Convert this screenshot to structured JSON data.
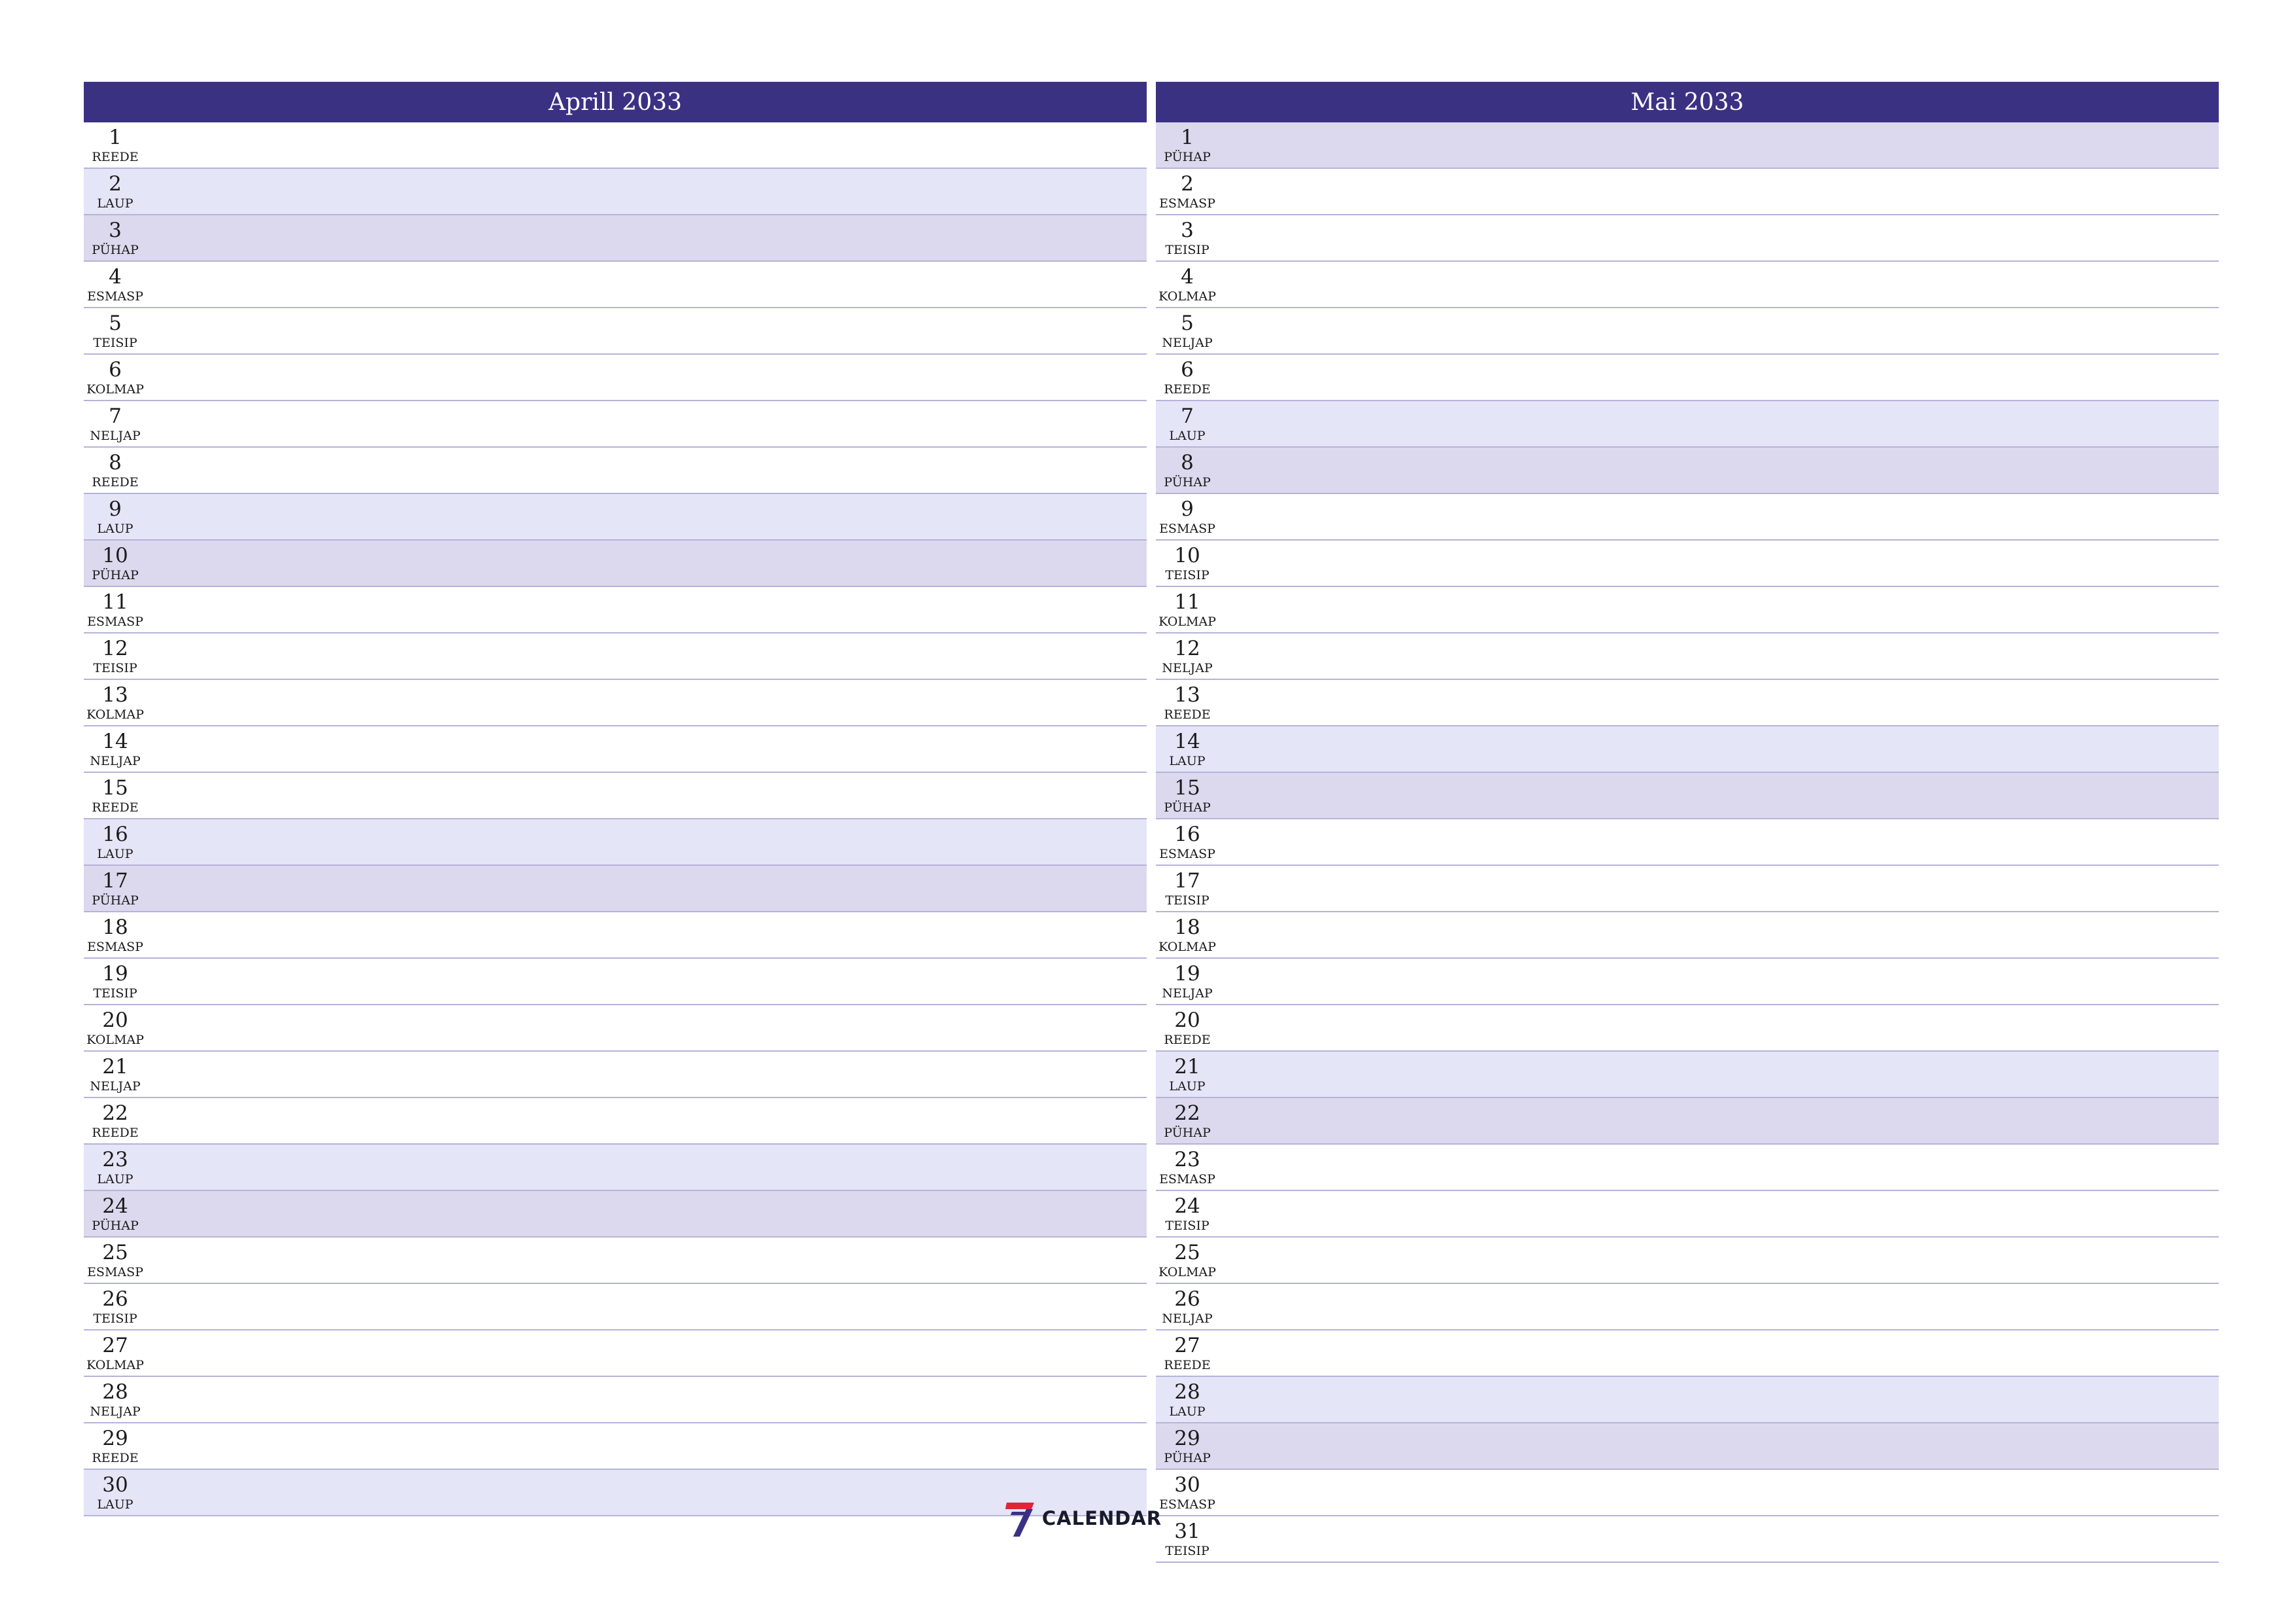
{
  "colors": {
    "header_bg": "#3b3183",
    "header_text": "#ffffff",
    "saturday_bg": "#e5e5f8",
    "sunday_bg": "#dcd8ee",
    "row_divider": "#b6b3d8",
    "logo_red": "#e0243b",
    "logo_blue": "#3b3183"
  },
  "months": [
    {
      "title": "Aprill 2033",
      "days": [
        {
          "num": "1",
          "name": "REEDE",
          "type": "weekday"
        },
        {
          "num": "2",
          "name": "LAUP",
          "type": "sat"
        },
        {
          "num": "3",
          "name": "PÜHAP",
          "type": "sun"
        },
        {
          "num": "4",
          "name": "ESMASP",
          "type": "weekday"
        },
        {
          "num": "5",
          "name": "TEISIP",
          "type": "weekday"
        },
        {
          "num": "6",
          "name": "KOLMAP",
          "type": "weekday"
        },
        {
          "num": "7",
          "name": "NELJAP",
          "type": "weekday"
        },
        {
          "num": "8",
          "name": "REEDE",
          "type": "weekday"
        },
        {
          "num": "9",
          "name": "LAUP",
          "type": "sat"
        },
        {
          "num": "10",
          "name": "PÜHAP",
          "type": "sun"
        },
        {
          "num": "11",
          "name": "ESMASP",
          "type": "weekday"
        },
        {
          "num": "12",
          "name": "TEISIP",
          "type": "weekday"
        },
        {
          "num": "13",
          "name": "KOLMAP",
          "type": "weekday"
        },
        {
          "num": "14",
          "name": "NELJAP",
          "type": "weekday"
        },
        {
          "num": "15",
          "name": "REEDE",
          "type": "weekday"
        },
        {
          "num": "16",
          "name": "LAUP",
          "type": "sat"
        },
        {
          "num": "17",
          "name": "PÜHAP",
          "type": "sun"
        },
        {
          "num": "18",
          "name": "ESMASP",
          "type": "weekday"
        },
        {
          "num": "19",
          "name": "TEISIP",
          "type": "weekday"
        },
        {
          "num": "20",
          "name": "KOLMAP",
          "type": "weekday"
        },
        {
          "num": "21",
          "name": "NELJAP",
          "type": "weekday"
        },
        {
          "num": "22",
          "name": "REEDE",
          "type": "weekday"
        },
        {
          "num": "23",
          "name": "LAUP",
          "type": "sat"
        },
        {
          "num": "24",
          "name": "PÜHAP",
          "type": "sun"
        },
        {
          "num": "25",
          "name": "ESMASP",
          "type": "weekday"
        },
        {
          "num": "26",
          "name": "TEISIP",
          "type": "weekday"
        },
        {
          "num": "27",
          "name": "KOLMAP",
          "type": "weekday"
        },
        {
          "num": "28",
          "name": "NELJAP",
          "type": "weekday"
        },
        {
          "num": "29",
          "name": "REEDE",
          "type": "weekday"
        },
        {
          "num": "30",
          "name": "LAUP",
          "type": "sat"
        }
      ]
    },
    {
      "title": "Mai 2033",
      "days": [
        {
          "num": "1",
          "name": "PÜHAP",
          "type": "sun"
        },
        {
          "num": "2",
          "name": "ESMASP",
          "type": "weekday"
        },
        {
          "num": "3",
          "name": "TEISIP",
          "type": "weekday"
        },
        {
          "num": "4",
          "name": "KOLMAP",
          "type": "weekday"
        },
        {
          "num": "5",
          "name": "NELJAP",
          "type": "weekday"
        },
        {
          "num": "6",
          "name": "REEDE",
          "type": "weekday"
        },
        {
          "num": "7",
          "name": "LAUP",
          "type": "sat"
        },
        {
          "num": "8",
          "name": "PÜHAP",
          "type": "sun"
        },
        {
          "num": "9",
          "name": "ESMASP",
          "type": "weekday"
        },
        {
          "num": "10",
          "name": "TEISIP",
          "type": "weekday"
        },
        {
          "num": "11",
          "name": "KOLMAP",
          "type": "weekday"
        },
        {
          "num": "12",
          "name": "NELJAP",
          "type": "weekday"
        },
        {
          "num": "13",
          "name": "REEDE",
          "type": "weekday"
        },
        {
          "num": "14",
          "name": "LAUP",
          "type": "sat"
        },
        {
          "num": "15",
          "name": "PÜHAP",
          "type": "sun"
        },
        {
          "num": "16",
          "name": "ESMASP",
          "type": "weekday"
        },
        {
          "num": "17",
          "name": "TEISIP",
          "type": "weekday"
        },
        {
          "num": "18",
          "name": "KOLMAP",
          "type": "weekday"
        },
        {
          "num": "19",
          "name": "NELJAP",
          "type": "weekday"
        },
        {
          "num": "20",
          "name": "REEDE",
          "type": "weekday"
        },
        {
          "num": "21",
          "name": "LAUP",
          "type": "sat"
        },
        {
          "num": "22",
          "name": "PÜHAP",
          "type": "sun"
        },
        {
          "num": "23",
          "name": "ESMASP",
          "type": "weekday"
        },
        {
          "num": "24",
          "name": "TEISIP",
          "type": "weekday"
        },
        {
          "num": "25",
          "name": "KOLMAP",
          "type": "weekday"
        },
        {
          "num": "26",
          "name": "NELJAP",
          "type": "weekday"
        },
        {
          "num": "27",
          "name": "REEDE",
          "type": "weekday"
        },
        {
          "num": "28",
          "name": "LAUP",
          "type": "sat"
        },
        {
          "num": "29",
          "name": "PÜHAP",
          "type": "sun"
        },
        {
          "num": "30",
          "name": "ESMASP",
          "type": "weekday"
        },
        {
          "num": "31",
          "name": "TEISIP",
          "type": "weekday"
        }
      ]
    }
  ],
  "logo": {
    "mark_icon": "seven-calendar-logo-icon",
    "text": "CALENDAR"
  }
}
